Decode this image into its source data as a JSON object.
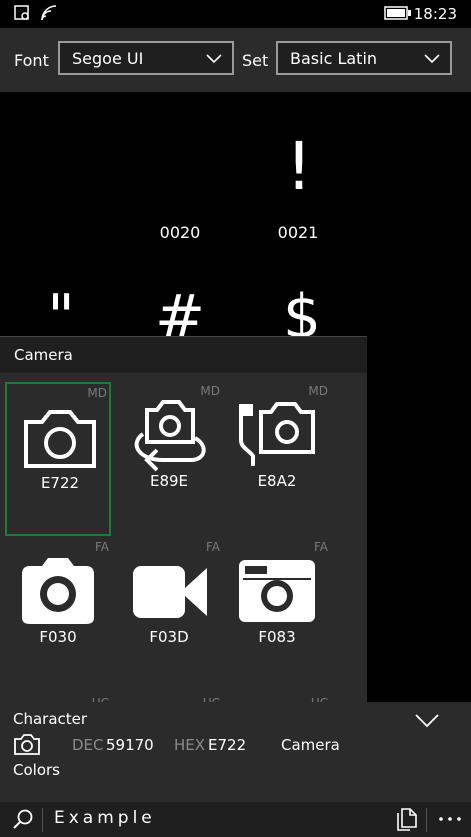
{
  "status": {
    "time": "18:23"
  },
  "toolbar": {
    "font_label": "Font",
    "font_value": "Segoe UI",
    "set_label": "Set",
    "set_value": "Basic Latin"
  },
  "grid": {
    "cells": [
      {
        "glyph": "!",
        "code": "0021"
      },
      {
        "glyph": "",
        "code": "0020"
      },
      {
        "glyph": "\"",
        "code": ""
      },
      {
        "glyph": "#",
        "code": ""
      },
      {
        "glyph": "$",
        "code": ""
      }
    ]
  },
  "panel": {
    "title": "Camera",
    "items": [
      {
        "code": "E722",
        "tag": "MD"
      },
      {
        "code": "E89E",
        "tag": "MD"
      },
      {
        "code": "E8A2",
        "tag": "MD"
      },
      {
        "code": "F030",
        "tag": "FA"
      },
      {
        "code": "F03D",
        "tag": "FA"
      },
      {
        "code": "F083",
        "tag": "FA"
      },
      {
        "code": "",
        "tag": "UC"
      },
      {
        "code": "",
        "tag": "UC"
      },
      {
        "code": "",
        "tag": "UC"
      }
    ]
  },
  "info": {
    "heading": "Character",
    "dec_label": "DEC",
    "dec_value": "59170",
    "hex_label": "HEX",
    "hex_value": "E722",
    "name": "Camera",
    "colors_label": "Colors"
  },
  "bottom": {
    "example_text": "Example"
  }
}
